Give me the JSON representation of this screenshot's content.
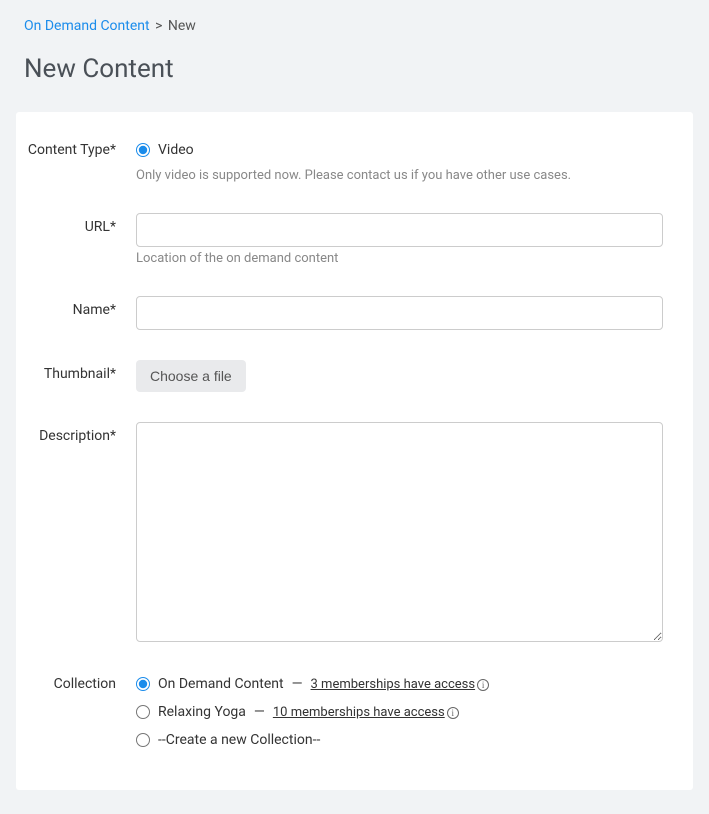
{
  "breadcrumb": {
    "parent": "On Demand Content",
    "separator": ">",
    "current": "New"
  },
  "page_title": "New Content",
  "content_type": {
    "label": "Content Type*",
    "option_video": "Video",
    "helper": "Only video is supported now. Please contact us if you have other use cases."
  },
  "url": {
    "label": "URL*",
    "value": "",
    "helper": "Location of the on demand content"
  },
  "name": {
    "label": "Name*",
    "value": ""
  },
  "thumbnail": {
    "label": "Thumbnail*",
    "button_label": "Choose a file"
  },
  "description": {
    "label": "Description*",
    "value": ""
  },
  "collection": {
    "label": "Collection",
    "options": [
      {
        "name": "On Demand Content",
        "access_text": "3 memberships have access",
        "has_info": true
      },
      {
        "name": "Relaxing Yoga",
        "access_text": "10 memberships have access",
        "has_info": true
      }
    ],
    "create_new": "--Create a new Collection--"
  }
}
